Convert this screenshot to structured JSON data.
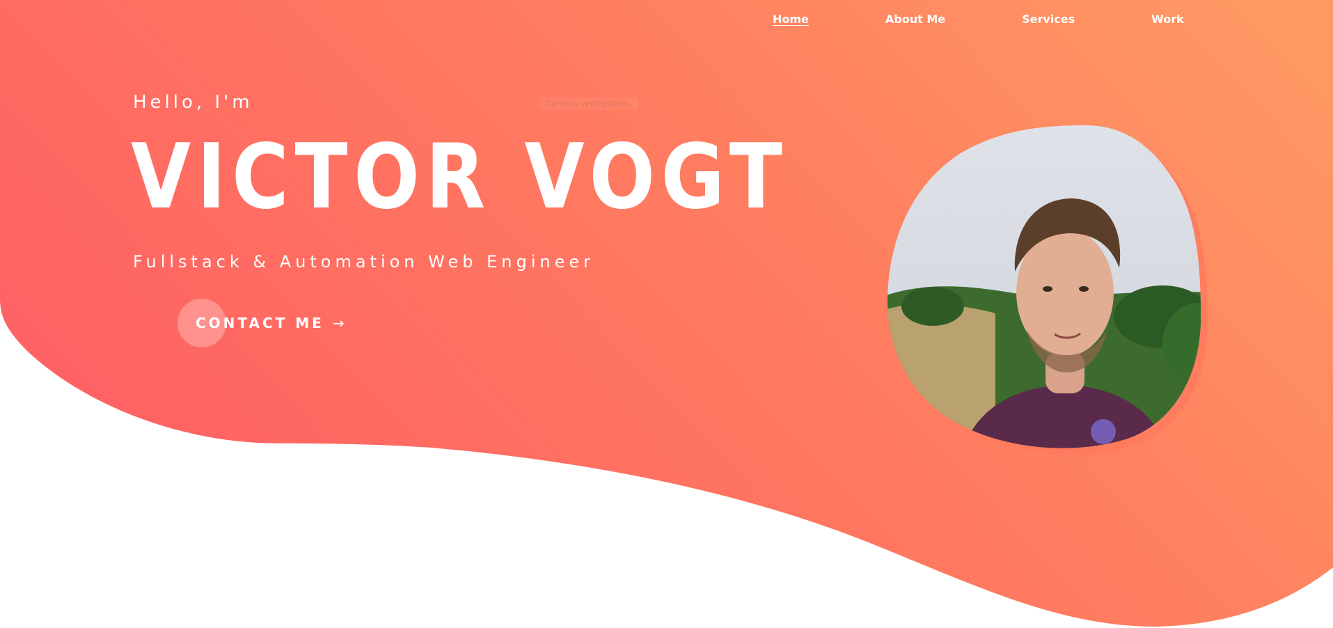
{
  "nav": {
    "items": [
      {
        "label": "Home",
        "active": true
      },
      {
        "label": "About Me",
        "active": false
      },
      {
        "label": "Services",
        "active": false
      },
      {
        "label": "Work",
        "active": false
      }
    ]
  },
  "hero": {
    "greeting": "Hello, I'm",
    "name": "VICTOR VOGT",
    "subtitle": "Fullstack & Automation Web Engineer",
    "cta_label": "CONTACT ME",
    "cta_icon": "arrow-right-icon",
    "ghost_note": "Cambia vertegültnis"
  },
  "photo": {
    "subject": "portrait-photo"
  },
  "colors": {
    "gradient_start": "#ff6062",
    "gradient_end": "#ff9a63",
    "text": "#ffffff",
    "background": "#ffffff"
  }
}
